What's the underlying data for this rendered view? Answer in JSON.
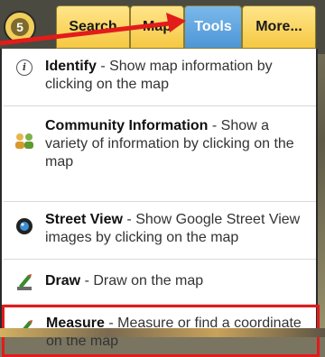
{
  "toolbar": {
    "home_glyph": "5",
    "tabs": [
      {
        "label": "Search"
      },
      {
        "label": "Map"
      },
      {
        "label": "Tools"
      },
      {
        "label": "More..."
      }
    ],
    "active_tab": "Tools"
  },
  "menu": {
    "items": [
      {
        "title": "Identify",
        "desc": " - Show map information by clicking on the map",
        "icon": "info-icon"
      },
      {
        "title": "Community Information",
        "desc": " - Show a variety of information by clicking on the map",
        "icon": "community-icon"
      },
      {
        "title": "Street View",
        "desc": " - Show Google Street View images by clicking on the map",
        "icon": "camera-icon"
      },
      {
        "title": "Draw",
        "desc": " - Draw on the map",
        "icon": "pencil-ruler-icon"
      },
      {
        "title": "Measure",
        "desc": " - Measure or find a coordinate on the map",
        "icon": "pencil-ruler-icon"
      }
    ],
    "highlighted_item": "Measure"
  },
  "colors": {
    "active_tab": "#4d96d6",
    "tab": "#f5c842",
    "highlight_border": "#e21b1b",
    "arrow": "#e21b1b"
  }
}
